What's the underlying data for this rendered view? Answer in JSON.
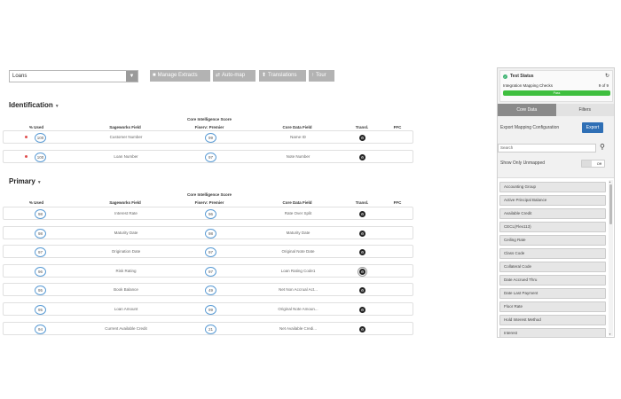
{
  "toolbar": {
    "select_value": "Loans",
    "buttons": [
      "Manage Extracts",
      "Auto-map",
      "Translations",
      "Tour"
    ]
  },
  "columns": {
    "used": "% Used",
    "field": "Sageworks Field",
    "score_line1": "Core Intelligence Score",
    "score_line2": "Fiserv: Premier",
    "core": "Core Data Field",
    "transl": "Transl.",
    "ffc": "FFC"
  },
  "identification": {
    "title": "Identification",
    "rows": [
      {
        "used": "100",
        "field": "Customer Number",
        "score": "99",
        "core": "Name ID"
      },
      {
        "used": "100",
        "field": "Loan Number",
        "score": "97",
        "core": "Note Number"
      }
    ]
  },
  "primary": {
    "title": "Primary",
    "rows": [
      {
        "used": "98",
        "field": "Interest Rate",
        "score": "96",
        "core": "Rate Over Split"
      },
      {
        "used": "98",
        "field": "Maturity Date",
        "score": "98",
        "core": "Maturity Date"
      },
      {
        "used": "97",
        "field": "Origination Date",
        "score": "97",
        "core": "Original Note Date"
      },
      {
        "used": "96",
        "field": "Risk Rating",
        "score": "97",
        "core": "Loan Rating Code1"
      },
      {
        "used": "95",
        "field": "Book Balance",
        "score": "49",
        "core": "Net Non Accrual Act..."
      },
      {
        "used": "95",
        "field": "Loan Amount",
        "score": "99",
        "core": "Original Note Amoun..."
      },
      {
        "used": "94",
        "field": "Current Available Credit",
        "score": "21",
        "core": "Net Available Credi..."
      }
    ]
  },
  "panel": {
    "status_title": "Test Status",
    "status_label": "Integration Mapping Checks",
    "status_count": "9 of 9",
    "status_progress": 1.0,
    "status_bar_text": "Pass",
    "tabs": [
      "Core Data",
      "Filters"
    ],
    "export_label": "Export Mapping Configuration",
    "export_button": "Export",
    "search_placeholder": "Search",
    "unmapped_label": "Show Only Unmapped",
    "toggle_label": "Off",
    "list": [
      "Accounting Group",
      "Active Principal Balance",
      "Available Credit",
      "CECL(Flex113)",
      "Ceiling Rate",
      "Class Code",
      "Collateral Code",
      "Date Accrued Thru",
      "Date Last Payment",
      "Floor Rate",
      "Hold Interest Method",
      "Interest"
    ]
  },
  "colors": {
    "accent": "#2f6fb5",
    "success": "#3fbf3f",
    "button_gray": "#b3b3b3",
    "required_dot": "#e05050"
  }
}
